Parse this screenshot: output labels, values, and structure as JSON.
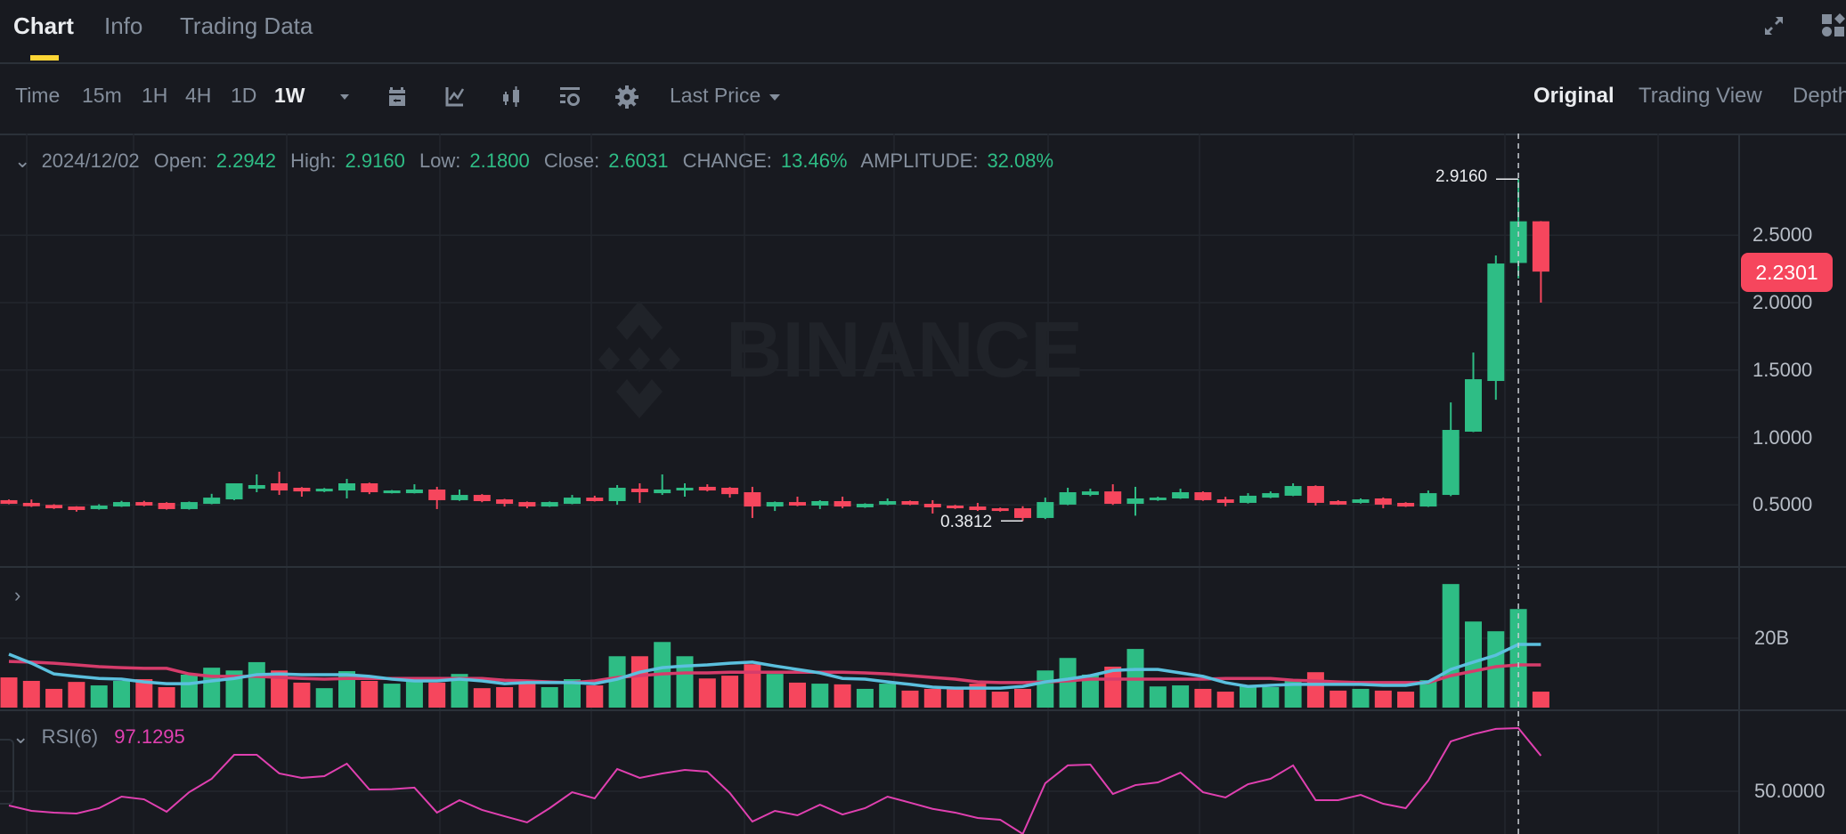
{
  "tabs": [
    {
      "label": "Chart",
      "active": true
    },
    {
      "label": "Info",
      "active": false
    },
    {
      "label": "Trading Data",
      "active": false
    }
  ],
  "top_icons": [
    "expand-icon",
    "layout-shapes-icon"
  ],
  "toolbar": {
    "intervals": [
      {
        "label": "Time",
        "active": false
      },
      {
        "label": "15m",
        "active": false
      },
      {
        "label": "1H",
        "active": false
      },
      {
        "label": "4H",
        "active": false
      },
      {
        "label": "1D",
        "active": false
      },
      {
        "label": "1W",
        "active": true
      }
    ],
    "more_intervals_icon": "caret-down-icon",
    "tool_icons": [
      "calendar-icon",
      "indicator-icon",
      "candlestick-type-icon",
      "chart-settings-icon",
      "gear-icon"
    ],
    "price_type": "Last Price",
    "views": [
      {
        "label": "Original",
        "active": true
      },
      {
        "label": "Trading View",
        "active": false
      },
      {
        "label": "Depth",
        "active": false
      }
    ]
  },
  "ohlc": {
    "date": "2024/12/02",
    "open_label": "Open:",
    "open": "2.2942",
    "high_label": "High:",
    "high": "2.9160",
    "low_label": "Low:",
    "low": "2.1800",
    "close_label": "Close:",
    "close": "2.6031",
    "change_label": "CHANGE:",
    "change": "13.46%",
    "amplitude_label": "AMPLITUDE:",
    "amplitude": "32.08%"
  },
  "watermark": "BINANCE",
  "colors": {
    "up": "#2ebd85",
    "down": "#f6465d",
    "ma_fast": "#5bc0de",
    "ma_slow": "#d63c6b",
    "rsi": "#e040b0",
    "accent": "#fcd535"
  },
  "chart_data": {
    "type": "candlestick",
    "interval": "1W",
    "price_axis": {
      "ticks": [
        "2.5000",
        "2.0000",
        "1.5000",
        "1.0000",
        "0.5000"
      ],
      "range": [
        0.0,
        3.25
      ]
    },
    "last_price": "2.2301",
    "max_annotation": "2.9160",
    "min_annotation": "0.3812",
    "crosshair_index": 67,
    "candles": [
      [
        0.535,
        0.54,
        0.505,
        0.508
      ],
      [
        0.515,
        0.54,
        0.485,
        0.49
      ],
      [
        0.5,
        0.505,
        0.47,
        0.475
      ],
      [
        0.488,
        0.49,
        0.45,
        0.462
      ],
      [
        0.469,
        0.505,
        0.465,
        0.495
      ],
      [
        0.488,
        0.53,
        0.485,
        0.521
      ],
      [
        0.521,
        0.53,
        0.49,
        0.495
      ],
      [
        0.515,
        0.52,
        0.465,
        0.469
      ],
      [
        0.469,
        0.525,
        0.465,
        0.521
      ],
      [
        0.508,
        0.582,
        0.505,
        0.554
      ],
      [
        0.541,
        0.66,
        0.535,
        0.66
      ],
      [
        0.62,
        0.726,
        0.594,
        0.647
      ],
      [
        0.66,
        0.746,
        0.574,
        0.607
      ],
      [
        0.627,
        0.632,
        0.561,
        0.6
      ],
      [
        0.6,
        0.625,
        0.595,
        0.62
      ],
      [
        0.607,
        0.693,
        0.548,
        0.66
      ],
      [
        0.66,
        0.665,
        0.58,
        0.594
      ],
      [
        0.587,
        0.61,
        0.585,
        0.607
      ],
      [
        0.587,
        0.653,
        0.585,
        0.614
      ],
      [
        0.614,
        0.634,
        0.469,
        0.535
      ],
      [
        0.535,
        0.614,
        0.53,
        0.574
      ],
      [
        0.574,
        0.58,
        0.52,
        0.528
      ],
      [
        0.541,
        0.545,
        0.488,
        0.508
      ],
      [
        0.521,
        0.525,
        0.475,
        0.488
      ],
      [
        0.488,
        0.525,
        0.485,
        0.521
      ],
      [
        0.508,
        0.574,
        0.505,
        0.554
      ],
      [
        0.554,
        0.568,
        0.525,
        0.528
      ],
      [
        0.528,
        0.647,
        0.501,
        0.627
      ],
      [
        0.62,
        0.66,
        0.515,
        0.594
      ],
      [
        0.587,
        0.726,
        0.574,
        0.614
      ],
      [
        0.607,
        0.66,
        0.561,
        0.627
      ],
      [
        0.634,
        0.653,
        0.6,
        0.607
      ],
      [
        0.627,
        0.632,
        0.554,
        0.58
      ],
      [
        0.594,
        0.634,
        0.403,
        0.488
      ],
      [
        0.488,
        0.525,
        0.455,
        0.521
      ],
      [
        0.521,
        0.561,
        0.49,
        0.495
      ],
      [
        0.495,
        0.535,
        0.469,
        0.528
      ],
      [
        0.528,
        0.561,
        0.475,
        0.488
      ],
      [
        0.482,
        0.512,
        0.478,
        0.508
      ],
      [
        0.502,
        0.548,
        0.498,
        0.528
      ],
      [
        0.528,
        0.532,
        0.498,
        0.502
      ],
      [
        0.508,
        0.535,
        0.436,
        0.482
      ],
      [
        0.495,
        0.5,
        0.47,
        0.475
      ],
      [
        0.488,
        0.515,
        0.455,
        0.462
      ],
      [
        0.475,
        0.48,
        0.45,
        0.455
      ],
      [
        0.475,
        0.49,
        0.3812,
        0.403
      ],
      [
        0.403,
        0.554,
        0.395,
        0.521
      ],
      [
        0.502,
        0.627,
        0.498,
        0.594
      ],
      [
        0.574,
        0.62,
        0.565,
        0.6
      ],
      [
        0.6,
        0.653,
        0.5,
        0.508
      ],
      [
        0.508,
        0.634,
        0.42,
        0.548
      ],
      [
        0.535,
        0.561,
        0.53,
        0.554
      ],
      [
        0.548,
        0.62,
        0.545,
        0.594
      ],
      [
        0.594,
        0.6,
        0.53,
        0.535
      ],
      [
        0.541,
        0.56,
        0.49,
        0.515
      ],
      [
        0.515,
        0.587,
        0.51,
        0.568
      ],
      [
        0.554,
        0.6,
        0.55,
        0.587
      ],
      [
        0.568,
        0.66,
        0.565,
        0.64
      ],
      [
        0.64,
        0.645,
        0.495,
        0.515
      ],
      [
        0.528,
        0.535,
        0.5,
        0.502
      ],
      [
        0.515,
        0.548,
        0.51,
        0.541
      ],
      [
        0.548,
        0.555,
        0.475,
        0.502
      ],
      [
        0.515,
        0.52,
        0.485,
        0.488
      ],
      [
        0.488,
        0.607,
        0.485,
        0.587
      ],
      [
        0.574,
        1.26,
        0.565,
        1.056
      ],
      [
        1.043,
        1.63,
        1.04,
        1.432
      ],
      [
        1.419,
        2.35,
        1.28,
        2.29
      ],
      [
        2.2942,
        2.916,
        2.18,
        2.6031
      ],
      [
        2.6031,
        2.605,
        2.0,
        2.2301
      ]
    ],
    "volume_axis": {
      "ticks": [
        "20B"
      ],
      "unit": "B"
    },
    "volume": [
      8.7,
      7.7,
      5.4,
      7.4,
      6.4,
      7.7,
      8.2,
      5.9,
      9.5,
      11.5,
      10.7,
      13.1,
      10.7,
      7.2,
      5.6,
      10.5,
      7.7,
      6.9,
      7.7,
      7.2,
      9.7,
      5.6,
      5.9,
      7.2,
      5.9,
      8.2,
      6.4,
      14.8,
      14.8,
      18.9,
      14.8,
      8.4,
      9.2,
      12.5,
      9.7,
      7.2,
      6.9,
      6.7,
      5.4,
      6.9,
      4.9,
      5.4,
      5.4,
      6.9,
      4.6,
      5.4,
      10.7,
      14.3,
      9.5,
      11.8,
      16.9,
      6.1,
      6.4,
      5.4,
      4.6,
      6.4,
      5.9,
      8.2,
      10.2,
      4.9,
      5.4,
      4.9,
      4.6,
      7.9,
      35.6,
      24.8,
      22.0,
      28.4,
      4.6
    ],
    "volume_ma_fast": [
      15.4,
      12.8,
      9.7,
      9.0,
      8.4,
      8.2,
      7.4,
      6.9,
      6.9,
      7.7,
      8.4,
      9.5,
      9.7,
      9.5,
      9.5,
      9.5,
      9.0,
      8.2,
      7.7,
      7.7,
      8.2,
      7.7,
      6.9,
      7.2,
      7.2,
      7.2,
      6.9,
      8.2,
      10.2,
      11.5,
      12.0,
      12.3,
      12.8,
      13.1,
      12.0,
      11.0,
      10.0,
      8.4,
      8.2,
      7.4,
      6.7,
      5.9,
      5.6,
      5.6,
      5.6,
      6.1,
      7.4,
      8.2,
      9.2,
      10.7,
      11.0,
      11.0,
      10.0,
      9.0,
      7.2,
      6.1,
      6.4,
      6.7,
      6.7,
      6.7,
      6.7,
      6.4,
      6.4,
      7.4,
      11.0,
      13.1,
      15.1,
      18.2,
      18.2
    ],
    "volume_ma_slow": [
      13.3,
      13.1,
      12.8,
      12.3,
      11.8,
      11.5,
      11.3,
      11.3,
      9.7,
      9.0,
      9.0,
      9.0,
      8.7,
      8.4,
      8.2,
      8.4,
      8.4,
      8.4,
      8.4,
      8.4,
      8.4,
      8.4,
      7.9,
      7.7,
      7.4,
      7.2,
      7.7,
      8.7,
      9.2,
      9.7,
      10.0,
      10.0,
      10.2,
      10.2,
      10.2,
      10.2,
      10.2,
      10.2,
      10.0,
      9.7,
      9.2,
      8.7,
      8.2,
      7.4,
      7.2,
      7.2,
      7.4,
      7.7,
      8.2,
      8.2,
      8.2,
      8.2,
      8.2,
      8.2,
      8.4,
      8.4,
      8.4,
      7.9,
      7.7,
      7.4,
      7.2,
      7.2,
      7.2,
      7.2,
      9.2,
      10.5,
      11.8,
      12.3,
      12.3
    ],
    "rsi": {
      "label": "RSI(6)",
      "value": "97.1295",
      "axis_ticks": [
        "50.0000"
      ],
      "values": [
        39.4,
        35.4,
        34.1,
        33.4,
        37.4,
        46.0,
        44.0,
        34.7,
        49.3,
        59.3,
        77.2,
        77.2,
        63.3,
        60.0,
        61.3,
        70.6,
        51.3,
        51.6,
        52.7,
        34.1,
        43.4,
        36.1,
        31.4,
        26.8,
        37.4,
        49.3,
        44.7,
        66.6,
        60.0,
        63.3,
        65.9,
        64.6,
        48.7,
        27.4,
        35.4,
        32.1,
        40.0,
        32.7,
        37.4,
        46.0,
        41.5,
        36.9,
        34.1,
        30.1,
        28.8,
        18.2,
        56.0,
        69.3,
        69.9,
        48.0,
        54.6,
        56.6,
        63.9,
        49.3,
        45.4,
        55.3,
        59.3,
        69.3,
        43.4,
        43.4,
        47.3,
        40.7,
        37.4,
        58.0,
        87.2,
        92.5,
        96.5,
        97.1,
        76.5
      ]
    }
  }
}
